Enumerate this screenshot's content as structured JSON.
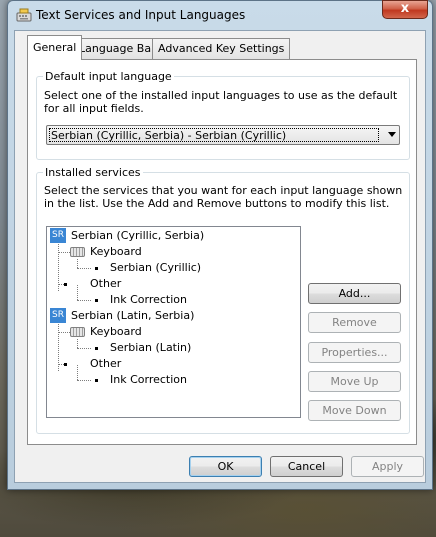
{
  "window": {
    "title": "Text Services and Input Languages",
    "close_label": "x"
  },
  "tabs": [
    {
      "label": "General",
      "selected": true
    },
    {
      "label": "Language Bar",
      "selected": false
    },
    {
      "label": "Advanced Key Settings",
      "selected": false
    }
  ],
  "default_input": {
    "group_label": "Default input language",
    "description": "Select one of the installed input languages to use as the default for all input fields.",
    "selected_value": "Serbian (Cyrillic, Serbia) - Serbian (Cyrillic)"
  },
  "installed_services": {
    "group_label": "Installed services",
    "description": "Select the services that you want for each input language shown in the list. Use the Add and Remove buttons to modify this list.",
    "tree": [
      {
        "badge": "SR",
        "language": "Serbian (Cyrillic, Serbia)",
        "keyboard_label": "Keyboard",
        "keyboard_item": "Serbian (Cyrillic)",
        "other_label": "Other",
        "other_item": "Ink Correction"
      },
      {
        "badge": "SR",
        "language": "Serbian (Latin, Serbia)",
        "keyboard_label": "Keyboard",
        "keyboard_item": "Serbian (Latin)",
        "other_label": "Other",
        "other_item": "Ink Correction"
      }
    ],
    "buttons": {
      "add": "Add...",
      "remove": "Remove",
      "properties": "Properties...",
      "move_up": "Move Up",
      "move_down": "Move Down"
    }
  },
  "footer": {
    "ok": "OK",
    "cancel": "Cancel",
    "apply": "Apply"
  },
  "colors": {
    "language_badge": "#3a86d4",
    "close_button": "#c0381f"
  },
  "icons": {
    "title": "keyboard-settings-icon",
    "tree_keyboard": "keyboard-icon"
  }
}
